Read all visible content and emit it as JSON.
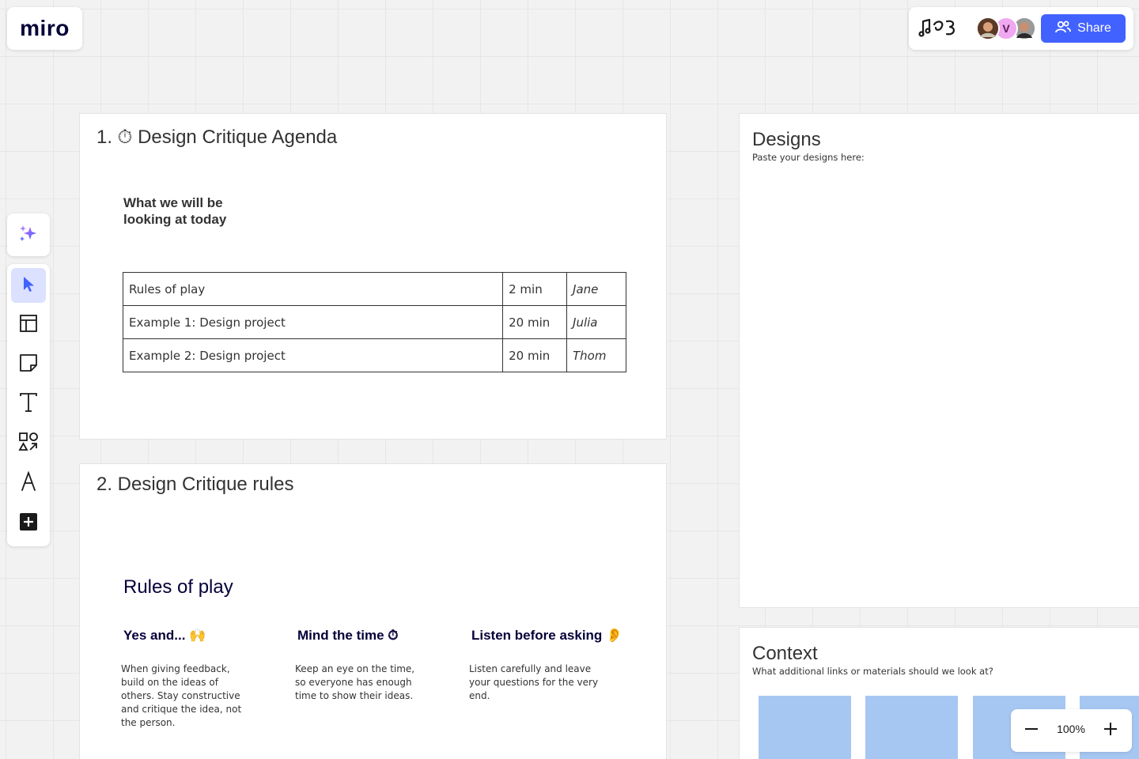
{
  "logo": {
    "text": "miro"
  },
  "topbar": {
    "avatars": [
      {
        "initial": "",
        "color": "#8a5a3c"
      },
      {
        "initial": "V",
        "color": "#f0a8f0"
      },
      {
        "initial": "",
        "color": "#6b6b6b"
      }
    ],
    "share_label": "Share"
  },
  "toolbar": {
    "tools": [
      "ai-sparkle",
      "select",
      "templates",
      "sticky-note",
      "text",
      "shapes",
      "pen",
      "more"
    ]
  },
  "agenda": {
    "title": "1. ⏱ Design Critique Agenda",
    "subtitle_line1": "What we will be",
    "subtitle_line2": "looking at today",
    "rows": [
      {
        "item": "Rules of play",
        "time": "2 min",
        "who": "Jane"
      },
      {
        "item": "Example 1: Design project",
        "time": "20 min",
        "who": "Julia"
      },
      {
        "item": "Example 2: Design project",
        "time": "20 min",
        "who": "Thom"
      }
    ]
  },
  "rules": {
    "title": "2. Design Critique rules",
    "heading": "Rules of play",
    "items": [
      {
        "title": "Yes and... 🙌",
        "body": "When giving feedback, build on the ideas of others. Stay constructive and critique the idea, not the person."
      },
      {
        "title": "Mind the time ⏱",
        "body": "Keep an eye on the time, so everyone has enough time to show their ideas."
      },
      {
        "title": "Listen before asking 👂",
        "body": "Listen carefully and leave your questions for the very end."
      }
    ]
  },
  "designs": {
    "title": "Designs",
    "subtitle": "Paste your designs here:"
  },
  "context": {
    "title": "Context",
    "subtitle": "What additional links or materials should we look at?"
  },
  "zoom": {
    "level": "100%"
  },
  "colors": {
    "accent": "#4262ff",
    "sticky": "#a6c7f2",
    "navy": "#050038"
  }
}
